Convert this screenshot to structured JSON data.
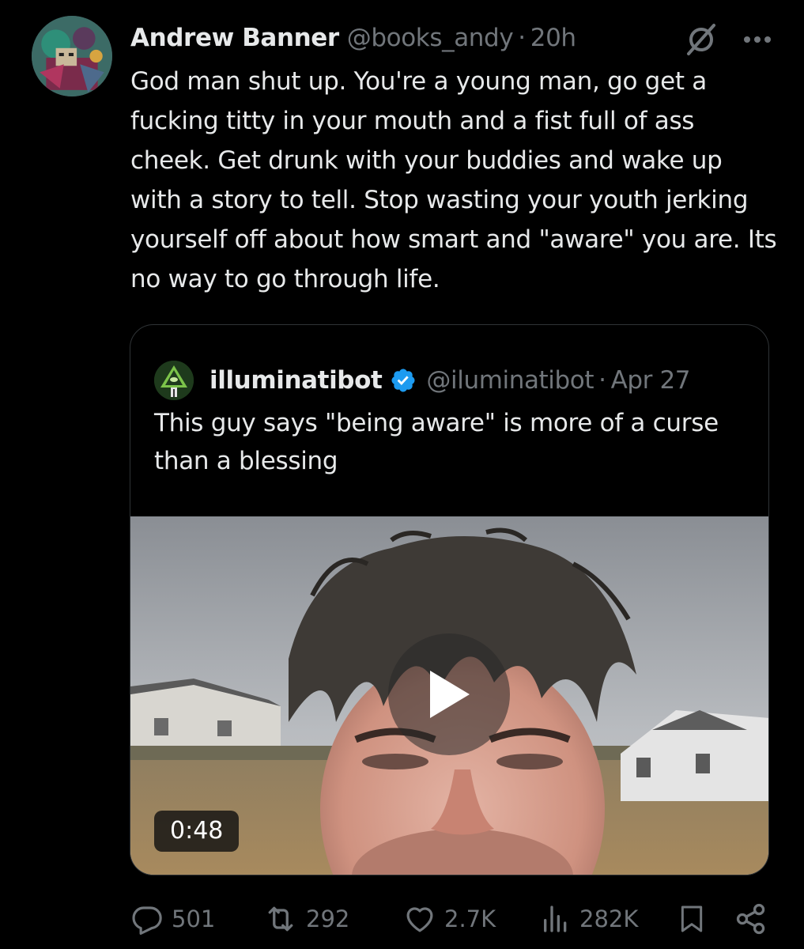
{
  "tweet": {
    "author_name": "Andrew Banner",
    "handle": "@books_andy",
    "separator": "·",
    "time": "20h",
    "text": "God man shut up. You're a young man, go get a fucking titty in your mouth and a fist full of ass cheek. Get drunk with your buddies and wake up with a story to tell. Stop wasting your youth jerking yourself off about how smart and \"aware\" you are. Its no way to go through life.",
    "icons": {
      "grok": "grok-icon",
      "more": "more-icon"
    }
  },
  "quote": {
    "author_name": "illuminatibot",
    "verified": true,
    "handle": "@iluminatibot",
    "separator": "·",
    "date": "Apr 27",
    "text": "This guy says \"being aware\" is more of a curse than a blessing",
    "media": {
      "type": "video",
      "duration": "0:48"
    }
  },
  "actions": {
    "replies": "501",
    "reposts": "292",
    "likes": "2.7K",
    "views": "282K"
  },
  "colors": {
    "background": "#000000",
    "text": "#e7e9ea",
    "muted": "#71767b",
    "verified": "#1d9bf0",
    "border": "#2f3336"
  }
}
